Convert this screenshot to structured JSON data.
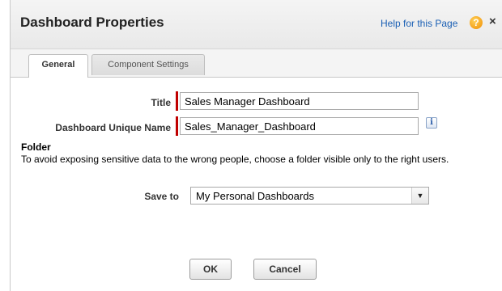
{
  "dialog": {
    "title": "Dashboard Properties",
    "help_link": "Help for this Page",
    "help_icon_glyph": "?",
    "close_glyph": "×"
  },
  "tabs": [
    {
      "label": "General",
      "active": true
    },
    {
      "label": "Component Settings",
      "active": false
    }
  ],
  "form": {
    "title_label": "Title",
    "title_value": "Sales Manager Dashboard",
    "unique_name_label": "Dashboard Unique Name",
    "unique_name_value": "Sales_Manager_Dashboard",
    "info_glyph": "i"
  },
  "folder": {
    "heading": "Folder",
    "description": "To avoid exposing sensitive data to the wrong people, choose a folder visible only to the right users.",
    "save_to_label": "Save to",
    "save_to_value": "My Personal Dashboards",
    "dropdown_glyph": "▼"
  },
  "buttons": {
    "ok": "OK",
    "cancel": "Cancel"
  },
  "colors": {
    "required_marker": "#c00000",
    "help_icon": "#f08c00",
    "link": "#1a5fb4"
  },
  "icons": {
    "help": "help-icon",
    "close": "close-icon",
    "info": "info-icon",
    "dropdown": "chevron-down-icon"
  }
}
